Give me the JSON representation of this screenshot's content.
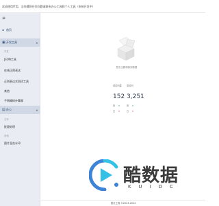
{
  "window": {
    "title": "欢迎使用IT用，当你遇到任何问题请联系办公工具和个人工具（系统开发中）"
  },
  "sidebar": {
    "menu_icon": "hamburger-icon",
    "items": [
      {
        "label": "首页",
        "icon": "home-icon"
      },
      {
        "label": "开发工具",
        "icon": "code-icon"
      },
      {
        "label": "开发",
        "type": "group"
      },
      {
        "label": "JSON工具"
      },
      {
        "label": "在线正则表达"
      },
      {
        "label": "正则表达式测试工具"
      },
      {
        "label": "其他"
      },
      {
        "label": "子网编码计算器"
      },
      {
        "label": "办公",
        "icon": "briefcase-icon"
      },
      {
        "label": "文本",
        "type": "group"
      },
      {
        "label": "批量处理"
      },
      {
        "label": "其他",
        "type": "group"
      },
      {
        "label": "图片混合水印"
      }
    ]
  },
  "main": {
    "empty_state": "暂无主题和使用数据",
    "stats": [
      {
        "label": "总访问量",
        "value": "152",
        "mini_label": "周",
        "mini_value": "0",
        "mini2_label": "日",
        "mini2_value": "0"
      },
      {
        "label": "总访问",
        "value": "3,251",
        "mini_label": "周",
        "mini_value": "0",
        "mini2_label": "日",
        "mini2_value": "0"
      }
    ]
  },
  "statusbar": {
    "text": "统计工具 ©2023-2024"
  },
  "watermark": {
    "big": "酷数据",
    "small": "KUIDC"
  },
  "colors": {
    "sidebar_bg": "#e9edf3",
    "accent": "#2f4d75",
    "watermark_blue": "#3d84d6",
    "watermark_cyan": "#35c0e6"
  }
}
